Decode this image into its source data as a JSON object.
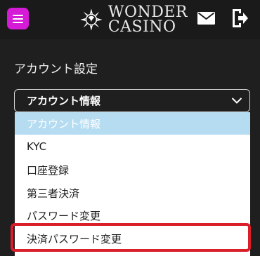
{
  "header": {
    "brand_line1": "WONDER",
    "brand_line2": "CASINO",
    "icons": [
      "menu-icon",
      "logo-icon",
      "mail-icon",
      "logout-icon"
    ],
    "colors": {
      "menu_button": "#d51bd6",
      "background": "#1a1a1a"
    }
  },
  "page": {
    "section_title": "アカウント設定"
  },
  "account_select": {
    "selected_value": "アカウント情報",
    "options": [
      {
        "label": "アカウント情報",
        "selected": true
      },
      {
        "label": "KYC",
        "selected": false
      },
      {
        "label": "口座登録",
        "selected": false
      },
      {
        "label": "第三者決済",
        "selected": false
      },
      {
        "label": "パスワード変更",
        "selected": false
      },
      {
        "label": "決済パスワード変更",
        "selected": false,
        "highlighted": true
      }
    ],
    "colors": {
      "selected_option_bg": "#b6dcf1",
      "highlight_border": "#d9202a"
    }
  }
}
